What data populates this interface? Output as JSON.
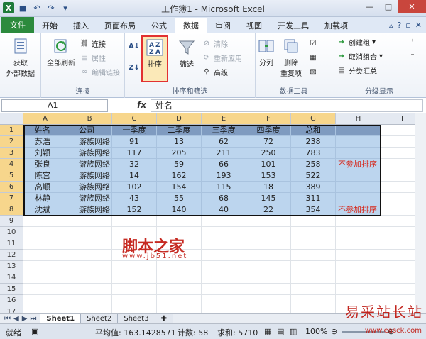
{
  "window": {
    "title": "工作簿1 - Microsoft Excel"
  },
  "tabs": [
    {
      "label": "文件"
    },
    {
      "label": "开始"
    },
    {
      "label": "插入"
    },
    {
      "label": "页面布局"
    },
    {
      "label": "公式"
    },
    {
      "label": "数据"
    },
    {
      "label": "审阅"
    },
    {
      "label": "视图"
    },
    {
      "label": "开发工具"
    },
    {
      "label": "加载项"
    }
  ],
  "ribbon": {
    "get_external": "获取\n外部数据",
    "refresh_all": "全部刷新",
    "connections": "连接",
    "properties": "属性",
    "edit_links": "编辑链接",
    "group_connections": "连接",
    "sort": "排序",
    "filter": "筛选",
    "clear": "清除",
    "reapply": "重新应用",
    "advanced": "高级",
    "group_sort_filter": "排序和筛选",
    "text_to_columns": "分列",
    "remove_duplicates": "删除\n重复项",
    "group_data_tools": "数据工具",
    "group": "创建组",
    "ungroup": "取消组合",
    "subtotal": "分类汇总",
    "group_outline": "分级显示"
  },
  "formula_bar": {
    "name_box": "A1",
    "fx": "fx",
    "content": "姓名"
  },
  "columns": [
    "A",
    "B",
    "C",
    "D",
    "E",
    "F",
    "G",
    "H",
    "I"
  ],
  "rows": [
    "1",
    "2",
    "3",
    "4",
    "5",
    "6",
    "7",
    "8",
    "9",
    "10",
    "11",
    "12",
    "13",
    "14",
    "15",
    "16",
    "17"
  ],
  "table": {
    "header": [
      "姓名",
      "公司",
      "一季度",
      "二季度",
      "三季度",
      "四季度",
      "总和"
    ],
    "data": [
      [
        "苏浩",
        "游族网络",
        "91",
        "13",
        "62",
        "72",
        "238"
      ],
      [
        "刘颖",
        "游族网络",
        "117",
        "205",
        "211",
        "250",
        "783"
      ],
      [
        "张良",
        "游族网络",
        "32",
        "59",
        "66",
        "101",
        "258"
      ],
      [
        "陈宫",
        "游族网络",
        "14",
        "162",
        "193",
        "153",
        "522"
      ],
      [
        "高顺",
        "游族网络",
        "102",
        "154",
        "115",
        "18",
        "389"
      ],
      [
        "林静",
        "游族网络",
        "43",
        "55",
        "68",
        "145",
        "311"
      ],
      [
        "沈斌",
        "游族网络",
        "152",
        "140",
        "40",
        "22",
        "354"
      ]
    ],
    "note_row4": "不参加排序",
    "note_row8": "不参加排序"
  },
  "watermark": {
    "main": "脚本之家",
    "url": "www.jb51.net"
  },
  "brand": {
    "name": "易采站长站",
    "url": "www.easck.com"
  },
  "sheets": [
    "Sheet1",
    "Sheet2",
    "Sheet3"
  ],
  "status": {
    "ready": "就绪",
    "average": "平均值: 163.1428571",
    "count": "计数: 58",
    "sum": "求和: 5710",
    "zoom": "100%"
  }
}
